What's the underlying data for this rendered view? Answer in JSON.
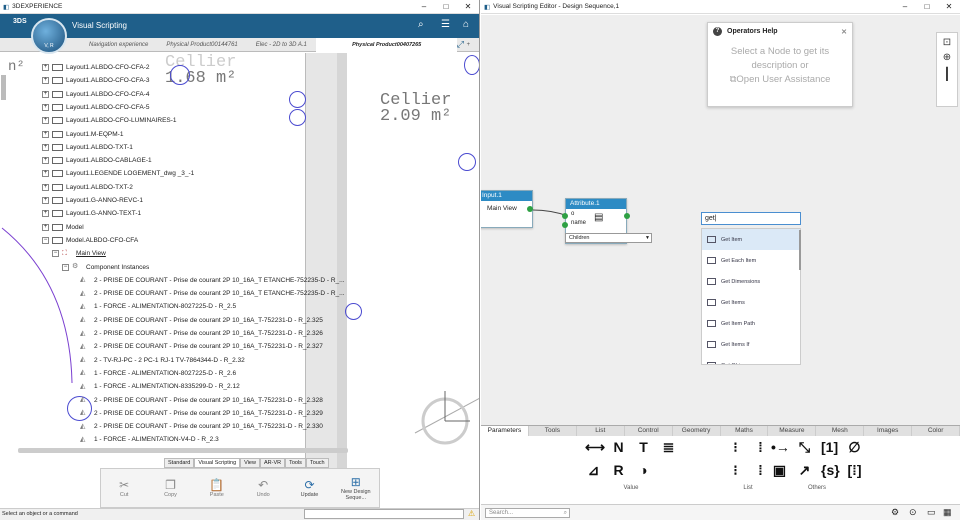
{
  "left_window": {
    "title": "3DEXPERIENCE",
    "app_title": "Visual Scripting",
    "brand": "3DS",
    "compass_label": "V, R",
    "tabs": [
      "Navigation experience",
      "Physical Product00144761",
      "Elec - 2D to 3D A.1",
      "Physical Product00407265",
      "+"
    ],
    "active_tab": 3,
    "room_labels": [
      {
        "name": "Cellier",
        "area": "1.68 m²"
      },
      {
        "name": "Cellier",
        "area": "2.09 m²"
      }
    ],
    "partial_label": "n²",
    "tree": [
      {
        "label": "Layout1.ALBDO-CFO-CFA-2",
        "kind": "layout"
      },
      {
        "label": "Layout1.ALBDO-CFO-CFA-3",
        "kind": "layout"
      },
      {
        "label": "Layout1.ALBDO-CFO-CFA-4",
        "kind": "layout"
      },
      {
        "label": "Layout1.ALBDO-CFO-CFA-5",
        "kind": "layout"
      },
      {
        "label": "Layout1.ALBDO-CFO-LUMINAIRES-1",
        "kind": "layout"
      },
      {
        "label": "Layout1.M-EQPM-1",
        "kind": "layout"
      },
      {
        "label": "Layout1.ALBDO-TXT-1",
        "kind": "layout"
      },
      {
        "label": "Layout1.ALBDO-CABLAGE-1",
        "kind": "layout"
      },
      {
        "label": "Layout1.LEGENDE LOGEMENT_dwg _3_-1",
        "kind": "layout"
      },
      {
        "label": "Layout1.ALBDO-TXT-2",
        "kind": "layout"
      },
      {
        "label": "Layout1.G-ANNO-REVC-1",
        "kind": "layout"
      },
      {
        "label": "Layout1.G-ANNO-TEXT-1",
        "kind": "layout"
      },
      {
        "label": "Model",
        "kind": "layout"
      },
      {
        "label": "Model.ALBDO-CFO-CFA",
        "kind": "expanded"
      },
      {
        "label": "Main View",
        "kind": "view"
      },
      {
        "label": "Component Instances",
        "kind": "group"
      },
      {
        "label": "2 - PRISE DE COURANT - Prise de courant 2P 10_16A_T ETANCHE-752235-D - R_...",
        "kind": "inst"
      },
      {
        "label": "2 - PRISE DE COURANT - Prise de courant 2P 10_16A_T ETANCHE-752235-D - R_...",
        "kind": "inst"
      },
      {
        "label": "1 - FORCE - ALIMENTATION-8027225-D - R_2.5",
        "kind": "inst"
      },
      {
        "label": "2 - PRISE DE COURANT - Prise de courant 2P 10_16A_T-752231-D - R_2.325",
        "kind": "inst"
      },
      {
        "label": "2 - PRISE DE COURANT - Prise de courant 2P 10_16A_T-752231-D - R_2.326",
        "kind": "inst"
      },
      {
        "label": "2 - PRISE DE COURANT - Prise de courant 2P 10_16A_T-752231-D - R_2.327",
        "kind": "inst"
      },
      {
        "label": "2 - TV-RJ-PC - 2 PC-1 RJ-1 TV-7864344-D - R_2.32",
        "kind": "inst"
      },
      {
        "label": "1 - FORCE - ALIMENTATION-8027225-D - R_2.6",
        "kind": "inst"
      },
      {
        "label": "1 - FORCE - ALIMENTATION-8335299-D - R_2.12",
        "kind": "inst"
      },
      {
        "label": "2 - PRISE DE COURANT - Prise de courant 2P 10_16A_T-752231-D - R_2.328",
        "kind": "inst"
      },
      {
        "label": "2 - PRISE DE COURANT - Prise de courant 2P 10_16A_T-752231-D - R_2.329",
        "kind": "inst"
      },
      {
        "label": "2 - PRISE DE COURANT - Prise de courant 2P 10_16A_T-752231-D - R_2.330",
        "kind": "inst"
      },
      {
        "label": "1 - FORCE - ALIMENTATION-V4-D - R_2.3",
        "kind": "inst"
      }
    ],
    "action_tabs": [
      "Standard",
      "Visual Scripting",
      "View",
      "AR-VR",
      "Tools",
      "Touch"
    ],
    "active_action_tab": 1,
    "actions": [
      {
        "label": "Cut",
        "icon": "✂"
      },
      {
        "label": "Copy",
        "icon": "❐"
      },
      {
        "label": "Paste",
        "icon": "📋"
      },
      {
        "label": "Undo",
        "icon": "↶"
      },
      {
        "label": "Update",
        "icon": "⟳"
      },
      {
        "label": "New Design Seque...",
        "icon": "⊞"
      }
    ],
    "status_text": "Select an object or a command"
  },
  "right_window": {
    "title": "Visual Scripting Editor - Design Sequence,1",
    "help": {
      "title": "Operators Help",
      "body_lines": [
        "Select a Node to get its",
        "description or",
        "Open User Assistance"
      ]
    },
    "node_input": {
      "title": "Input.1",
      "port": "Main View"
    },
    "node_attribute": {
      "title": "Attribute.1",
      "ports": [
        "o",
        "name"
      ],
      "select_value": "Children"
    },
    "search_value": "get",
    "suggestions": [
      "Get Item",
      "Get Each Item",
      "Get Dimensions",
      "Get Items",
      "Get Item Path",
      "Get Items If",
      "Get Obj..."
    ],
    "palette_tabs": [
      "Parameters",
      "Tools",
      "List",
      "Control",
      "Geometry",
      "Maths",
      "Measure",
      "Mesh",
      "Images",
      "Color"
    ],
    "active_palette_tab": 0,
    "groups": [
      {
        "label": "Value",
        "rows": [
          [
            "⟷",
            "N",
            "T",
            "≣"
          ],
          [
            "⊿",
            "R",
            "◑"
          ]
        ]
      },
      {
        "label": "List",
        "rows": [
          [
            "⁝",
            "⁞"
          ],
          [
            "⁝",
            "⁞"
          ]
        ]
      },
      {
        "label": "Others",
        "rows": [
          [
            "•→",
            "⤡",
            "[1]",
            "∅"
          ],
          [
            "▣",
            "↗",
            "{s}",
            "[⁞]"
          ]
        ]
      }
    ],
    "search_placeholder": "Search..."
  }
}
